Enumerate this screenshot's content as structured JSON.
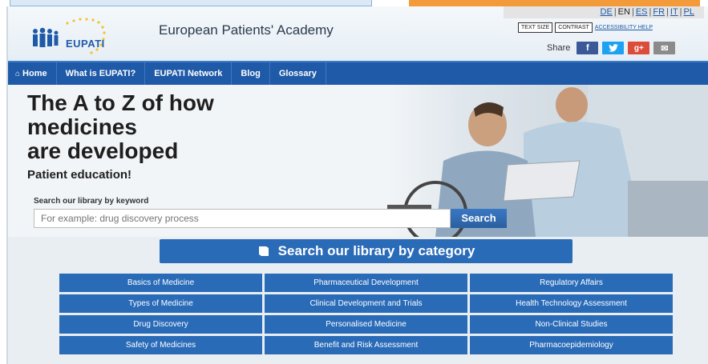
{
  "header": {
    "logo_text": "EUPATI",
    "site_title": "European Patients' Academy",
    "languages": [
      {
        "code": "DE",
        "current": false
      },
      {
        "code": "EN",
        "current": true
      },
      {
        "code": "ES",
        "current": false
      },
      {
        "code": "FR",
        "current": false
      },
      {
        "code": "IT",
        "current": false
      },
      {
        "code": "PL",
        "current": false
      }
    ],
    "text_size_label": "TEXT SIZE",
    "contrast_label": "CONTRAST",
    "accessibility_label": "ACCESSIBILITY HELP",
    "share_label": "Share",
    "share_buttons": [
      {
        "name": "facebook-icon",
        "glyph": "f"
      },
      {
        "name": "twitter-icon",
        "glyph": "t"
      },
      {
        "name": "google-plus-icon",
        "glyph": "g+"
      },
      {
        "name": "email-icon",
        "glyph": "✉"
      }
    ]
  },
  "nav": {
    "items": [
      "Home",
      "What is EUPATI?",
      "EUPATI Network",
      "Blog",
      "Glossary"
    ]
  },
  "hero": {
    "title_line1": "The A to Z of how",
    "title_line2": "medicines",
    "title_line3": "are developed",
    "subtitle": "Patient education!",
    "search_label": "Search our library by keyword",
    "search_placeholder": "For example: drug discovery process",
    "search_button": "Search"
  },
  "categories": {
    "heading": "Search our library by category",
    "items": [
      "Basics of Medicine",
      "Pharmaceutical Development",
      "Regulatory Affairs",
      "Types of Medicine",
      "Clinical Development and Trials",
      "Health Technology Assessment",
      "Drug Discovery",
      "Personalised Medicine",
      "Non-Clinical Studies",
      "Safety of Medicines",
      "Benefit and Risk Assessment",
      "Pharmacoepidemiology"
    ]
  },
  "colors": {
    "brand_blue": "#1f5aa8",
    "button_blue": "#2a6bb8",
    "accent_orange": "#f39a3a"
  }
}
